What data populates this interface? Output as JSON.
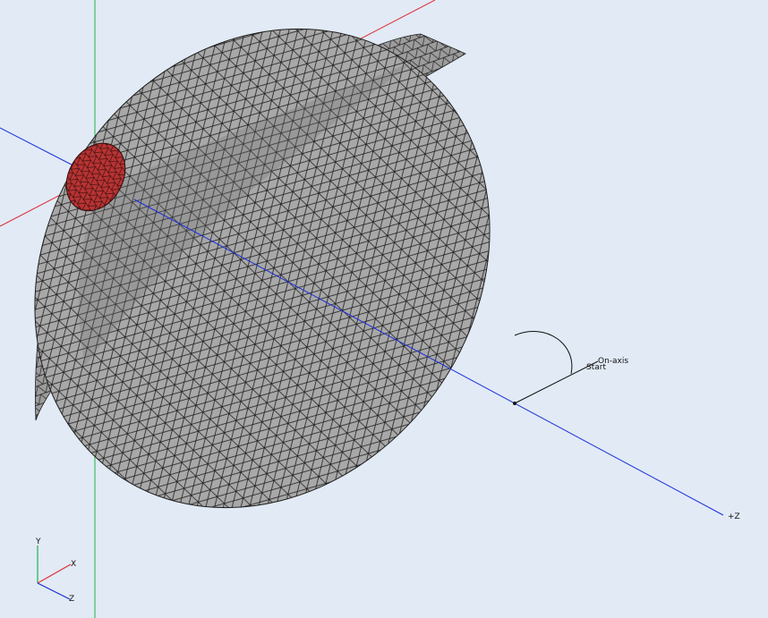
{
  "viewport": {
    "background": "#e1eaf5"
  },
  "axes": {
    "x_color": "#e0303a",
    "y_color": "#22b04a",
    "z_color": "#1a2fd8",
    "z_label": "+Z"
  },
  "mesh": {
    "fill_color": "#a8a8a8",
    "edge_color": "#1e1e1e",
    "throat_color": "#b83333"
  },
  "annotation": {
    "start_label": "Start",
    "onaxis_label": "On-axis"
  },
  "triad": {
    "x_label": "X",
    "y_label": "Y",
    "z_label": "Z"
  }
}
